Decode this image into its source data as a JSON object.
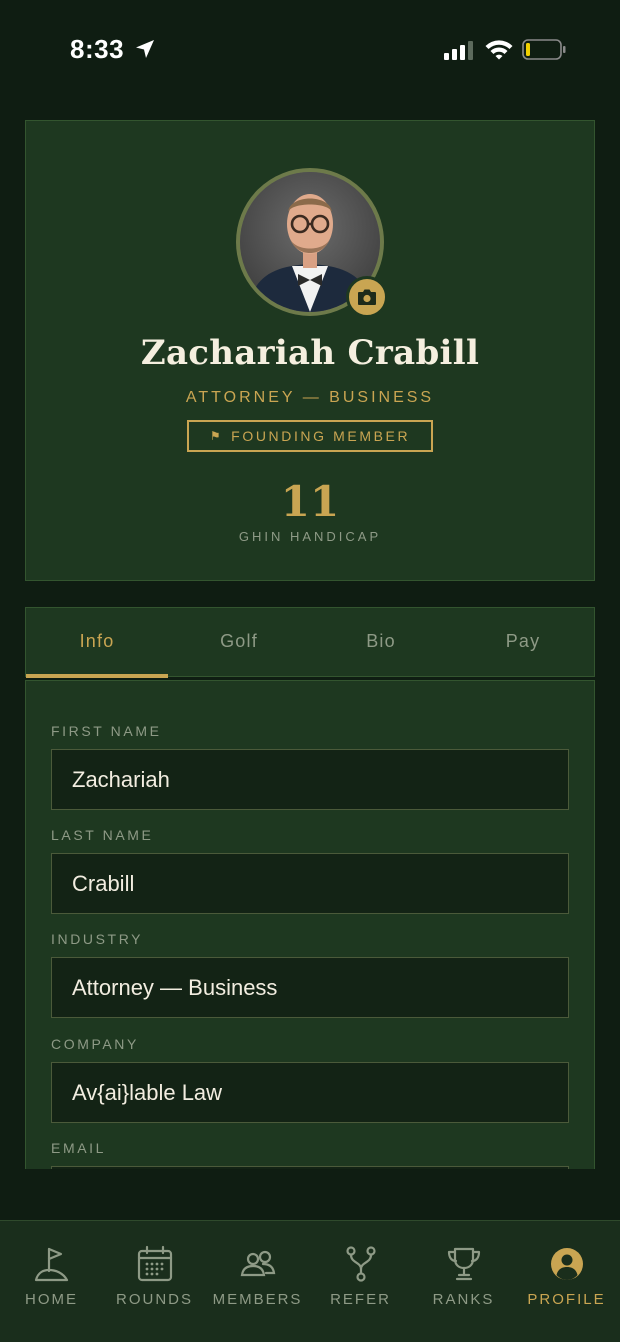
{
  "status_bar": {
    "time": "8:33"
  },
  "profile": {
    "name": "Zachariah Crabill",
    "role": "ATTORNEY — BUSINESS",
    "badge": "FOUNDING MEMBER",
    "handicap_value": "11",
    "handicap_label": "GHIN HANDICAP"
  },
  "tabs": [
    {
      "label": "Info",
      "active": true
    },
    {
      "label": "Golf",
      "active": false
    },
    {
      "label": "Bio",
      "active": false
    },
    {
      "label": "Pay",
      "active": false
    }
  ],
  "form": {
    "first_name": {
      "label": "FIRST NAME",
      "value": "Zachariah"
    },
    "last_name": {
      "label": "LAST NAME",
      "value": "Crabill"
    },
    "industry": {
      "label": "INDUSTRY",
      "value": "Attorney — Business"
    },
    "company": {
      "label": "COMPANY",
      "value": "Av{ai}lable Law"
    },
    "email": {
      "label": "EMAIL",
      "value": ""
    }
  },
  "nav": [
    {
      "label": "HOME",
      "icon": "golf-flag-icon",
      "active": false
    },
    {
      "label": "ROUNDS",
      "icon": "calendar-icon",
      "active": false
    },
    {
      "label": "MEMBERS",
      "icon": "members-icon",
      "active": false
    },
    {
      "label": "REFER",
      "icon": "refer-branch-icon",
      "active": false
    },
    {
      "label": "RANKS",
      "icon": "trophy-icon",
      "active": false
    },
    {
      "label": "PROFILE",
      "icon": "profile-icon",
      "active": true
    }
  ],
  "colors": {
    "background": "#0f1d12",
    "card": "#1e3820",
    "accent_gold": "#c9a552",
    "muted_text": "#8e9a86",
    "input_bg": "#132315"
  }
}
